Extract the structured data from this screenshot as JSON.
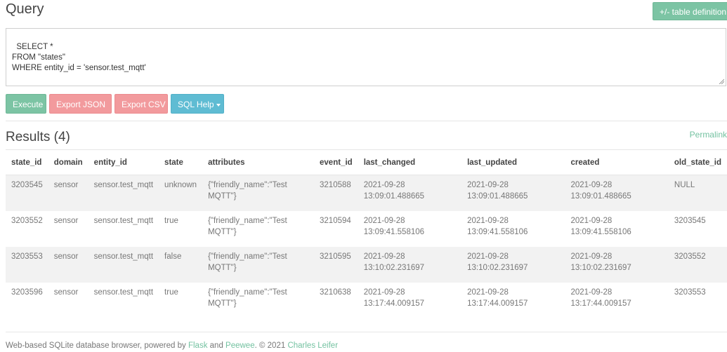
{
  "header": {
    "title": "Query",
    "table_def_label": "+/- table definition"
  },
  "query": {
    "text": "SELECT *\nFROM \"states\"\nWHERE entity_id = 'sensor.test_mqtt'"
  },
  "actions": {
    "execute": "Execute",
    "export_json": "Export JSON",
    "export_csv": "Export CSV",
    "sql_help": "SQL Help"
  },
  "results": {
    "title": "Results (4)",
    "permalink": "Permalink",
    "columns": [
      "state_id",
      "domain",
      "entity_id",
      "state",
      "attributes",
      "event_id",
      "last_changed",
      "last_updated",
      "created",
      "old_state_id"
    ],
    "rows": [
      [
        "3203545",
        "sensor",
        "sensor.test_mqtt",
        "unknown",
        "{\"friendly_name\":\"Test MQTT\"}",
        "3210588",
        "2021-09-28 13:09:01.488665",
        "2021-09-28 13:09:01.488665",
        "2021-09-28 13:09:01.488665",
        "NULL"
      ],
      [
        "3203552",
        "sensor",
        "sensor.test_mqtt",
        "true",
        "{\"friendly_name\":\"Test MQTT\"}",
        "3210594",
        "2021-09-28 13:09:41.558106",
        "2021-09-28 13:09:41.558106",
        "2021-09-28 13:09:41.558106",
        "3203545"
      ],
      [
        "3203553",
        "sensor",
        "sensor.test_mqtt",
        "false",
        "{\"friendly_name\":\"Test MQTT\"}",
        "3210595",
        "2021-09-28 13:10:02.231697",
        "2021-09-28 13:10:02.231697",
        "2021-09-28 13:10:02.231697",
        "3203552"
      ],
      [
        "3203596",
        "sensor",
        "sensor.test_mqtt",
        "true",
        "{\"friendly_name\":\"Test MQTT\"}",
        "3210638",
        "2021-09-28 13:17:44.009157",
        "2021-09-28 13:17:44.009157",
        "2021-09-28 13:17:44.009157",
        "3203553"
      ]
    ]
  },
  "footer": {
    "prefix": "Web-based SQLite database browser, powered by ",
    "flask": "Flask",
    "and": " and ",
    "peewee": "Peewee",
    "copyright": ". © 2021 ",
    "author": "Charles Leifer"
  },
  "colors": {
    "accent_green": "#7cc4a4",
    "export_pink": "#f29a9d",
    "help_blue": "#5fbcd3",
    "link_green": "#74c2a1"
  }
}
